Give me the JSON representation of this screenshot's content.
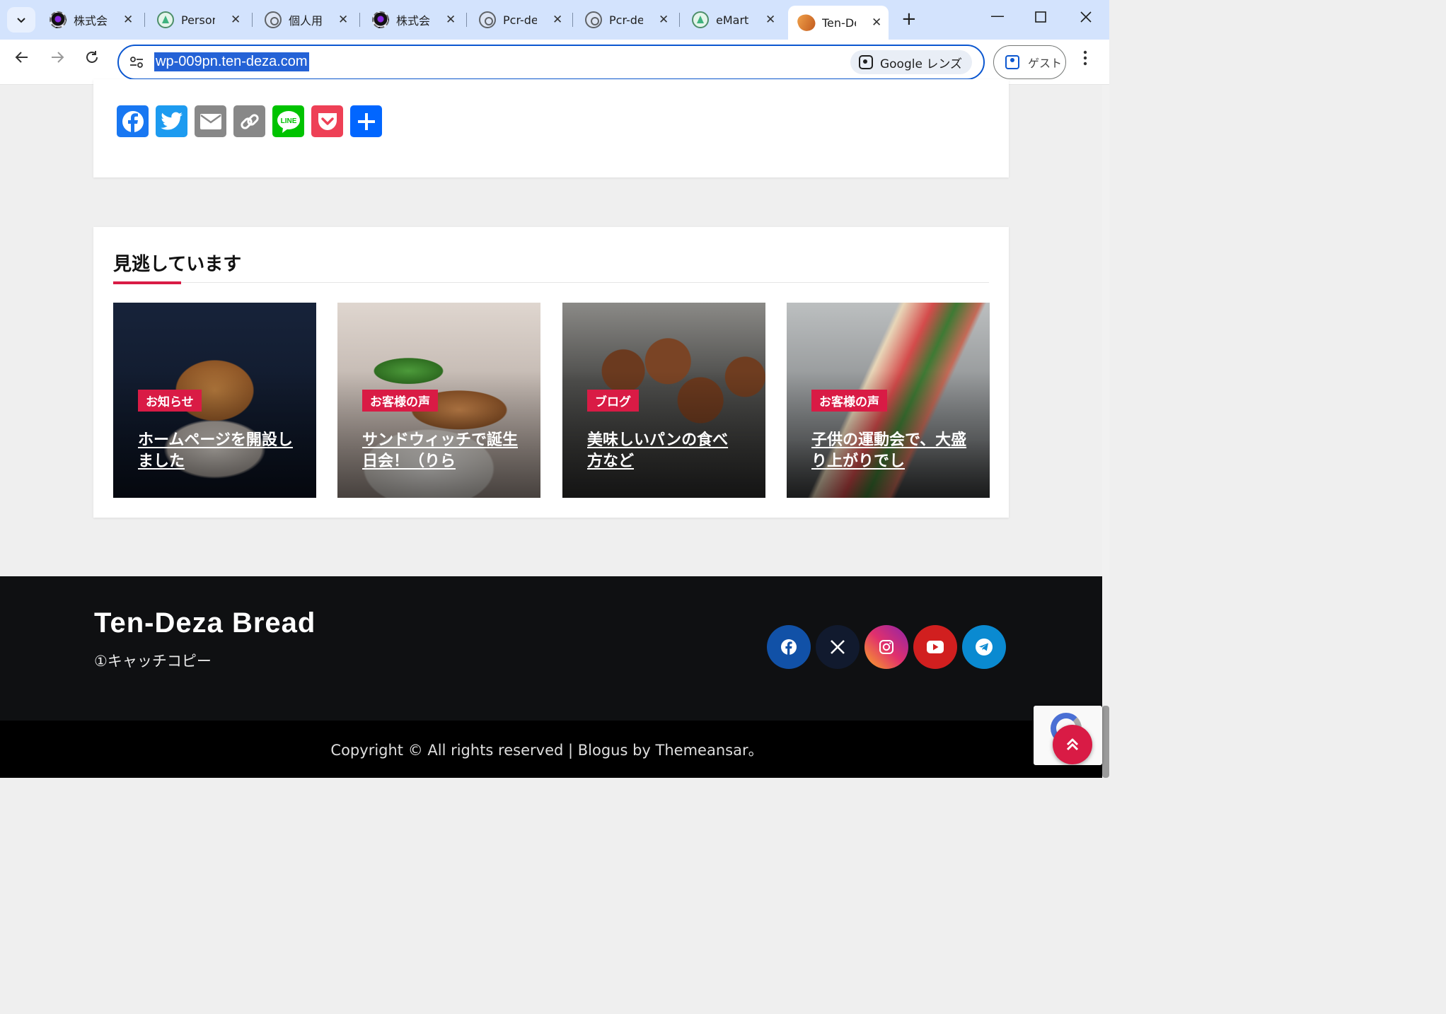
{
  "browser": {
    "tabs": [
      {
        "label": "株式会社",
        "favicon": "dark-logo-icon",
        "active": false
      },
      {
        "label": "Personal",
        "favicon": "green-peak-icon",
        "active": false
      },
      {
        "label": "個人用",
        "favicon": "globe-icon",
        "active": false
      },
      {
        "label": "株式会社",
        "favicon": "dark-logo-icon",
        "active": false
      },
      {
        "label": "Pcr-der",
        "favicon": "globe-icon",
        "active": false
      },
      {
        "label": "Pcr-der",
        "favicon": "globe-icon",
        "active": false
      },
      {
        "label": "eMart",
        "favicon": "green-peak-icon",
        "active": false
      },
      {
        "label": "Ten-De",
        "favicon": "bread-icon",
        "active": true
      }
    ],
    "url": "wp-009pn.ten-deza.com",
    "lens_label": "Google レンズ",
    "profile_label": "ゲスト"
  },
  "share": {
    "buttons": [
      {
        "name": "facebook",
        "color": "#1877f2"
      },
      {
        "name": "twitter",
        "color": "#1d9bf0"
      },
      {
        "name": "email",
        "color": "#888888"
      },
      {
        "name": "copy-link",
        "color": "#888888"
      },
      {
        "name": "line",
        "color": "#00c300",
        "text": "LINE"
      },
      {
        "name": "pocket",
        "color": "#ee4056"
      },
      {
        "name": "share",
        "color": "#0166ff"
      }
    ]
  },
  "missed": {
    "heading": "見逃しています",
    "posts": [
      {
        "category": "お知らせ",
        "title": "ホームページを開設しました"
      },
      {
        "category": "お客様の声",
        "title": "サンドウィッチで誕生日会！（りら"
      },
      {
        "category": "ブログ",
        "title": "美味しいパンの食べ方など"
      },
      {
        "category": "お客様の声",
        "title": "子供の運動会で、大盛り上がりでし"
      }
    ]
  },
  "footer": {
    "site_name": "Ten-Deza Bread",
    "tagline": "①キャッチコピー",
    "social": [
      {
        "name": "facebook",
        "color": "#1151a7"
      },
      {
        "name": "x",
        "color": "#111a2e"
      },
      {
        "name": "instagram",
        "color": "#e1306c"
      },
      {
        "name": "youtube",
        "color": "#d11f1f"
      },
      {
        "name": "telegram",
        "color": "#0a8ad1"
      }
    ],
    "copyright": "Copyright © All rights reserved | Blogus by Themeansar。"
  },
  "colors": {
    "accent": "#d91b45",
    "footer_bg": "#0f1012",
    "bottom_bar_bg": "#000000"
  }
}
